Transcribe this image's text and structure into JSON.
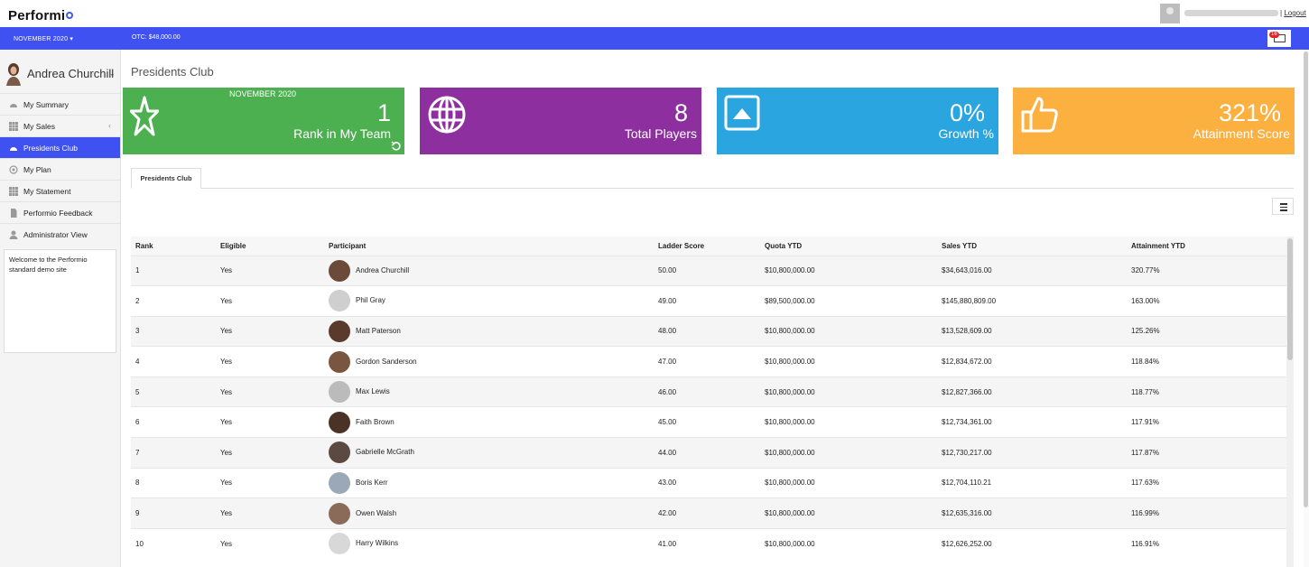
{
  "header": {
    "logo": "Performi",
    "logout": "Logout"
  },
  "bluebar": {
    "month": "NOVEMBER 2020",
    "otc": "OTC:  $48,000.00",
    "mail_count": "16"
  },
  "sidebar": {
    "user_name": "Andrea Churchill",
    "items": [
      {
        "label": "My Summary",
        "icon": "dashboard-icon"
      },
      {
        "label": "My Sales",
        "icon": "grid-icon"
      },
      {
        "label": "Presidents Club",
        "icon": "dashboard-icon"
      },
      {
        "label": "My Plan",
        "icon": "target-icon"
      },
      {
        "label": "My Statement",
        "icon": "grid-icon"
      },
      {
        "label": "Performio Feedback",
        "icon": "document-icon"
      },
      {
        "label": "Administrator View",
        "icon": "user-icon"
      }
    ],
    "welcome": "Welcome to the Performio standard demo site"
  },
  "main": {
    "title": "Presidents Club",
    "tiles": [
      {
        "value": "1",
        "label": "Rank in My Team",
        "subtitle": "NOVEMBER 2020",
        "color": "#4caf50",
        "icon": "star-icon"
      },
      {
        "value": "8",
        "label": "Total Players",
        "color": "#8e2fa0",
        "icon": "globe-icon"
      },
      {
        "value": "0%",
        "label": "Growth %",
        "color": "#2aa5e0",
        "icon": "arrow-up-box-icon"
      },
      {
        "value": "321%",
        "label": "Attainment Score",
        "color": "#fbb040",
        "icon": "thumbs-up-icon"
      }
    ],
    "tab": "Presidents Club",
    "table": {
      "headers": [
        "Rank",
        "Eligible",
        "Participant",
        "Ladder Score",
        "Quota YTD",
        "Sales YTD",
        "Attainment YTD"
      ],
      "rows": [
        [
          "1",
          "Yes",
          "Andrea Churchill",
          "50.00",
          "$10,800,000.00",
          "$34,643,016.00",
          "320.77%"
        ],
        [
          "2",
          "Yes",
          "Phil Gray",
          "49.00",
          "$89,500,000.00",
          "$145,880,809.00",
          "163.00%"
        ],
        [
          "3",
          "Yes",
          "Matt Paterson",
          "48.00",
          "$10,800,000.00",
          "$13,528,609.00",
          "125.26%"
        ],
        [
          "4",
          "Yes",
          "Gordon Sanderson",
          "47.00",
          "$10,800,000.00",
          "$12,834,672.00",
          "118.84%"
        ],
        [
          "5",
          "Yes",
          "Max Lewis",
          "46.00",
          "$10,800,000.00",
          "$12,827,366.00",
          "118.77%"
        ],
        [
          "6",
          "Yes",
          "Faith Brown",
          "45.00",
          "$10,800,000.00",
          "$12,734,361.00",
          "117.91%"
        ],
        [
          "7",
          "Yes",
          "Gabrielle McGrath",
          "44.00",
          "$10,800,000.00",
          "$12,730,217.00",
          "117.87%"
        ],
        [
          "8",
          "Yes",
          "Boris Kerr",
          "43.00",
          "$10,800,000.00",
          "$12,704,110.21",
          "117.63%"
        ],
        [
          "9",
          "Yes",
          "Owen Walsh",
          "42.00",
          "$10,800,000.00",
          "$12,635,316.00",
          "116.99%"
        ],
        [
          "10",
          "Yes",
          "Harry Wilkins",
          "41.00",
          "$10,800,000.00",
          "$12,626,252.00",
          "116.91%"
        ]
      ]
    }
  }
}
